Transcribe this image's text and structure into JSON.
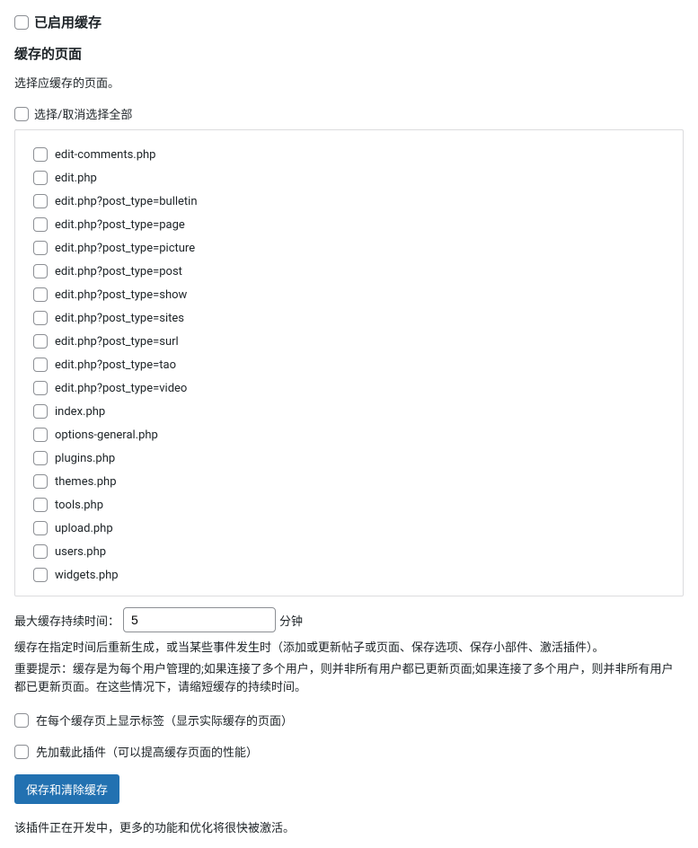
{
  "topCheckbox": {
    "label": "已启用缓存"
  },
  "section": {
    "title": "缓存的页面",
    "help": "选择应缓存的页面。"
  },
  "selectAll": {
    "label": "选择/取消选择全部"
  },
  "pages": [
    "edit-comments.php",
    "edit.php",
    "edit.php?post_type=bulletin",
    "edit.php?post_type=page",
    "edit.php?post_type=picture",
    "edit.php?post_type=post",
    "edit.php?post_type=show",
    "edit.php?post_type=sites",
    "edit.php?post_type=surl",
    "edit.php?post_type=tao",
    "edit.php?post_type=video",
    "index.php",
    "options-general.php",
    "plugins.php",
    "themes.php",
    "tools.php",
    "upload.php",
    "users.php",
    "widgets.php"
  ],
  "duration": {
    "label": "最大缓存持续时间：",
    "value": "5",
    "unit": "分钟"
  },
  "note1": "缓存在指定时间后重新生成，或当某些事件发生时（添加或更新帖子或页面、保存选项、保存小部件、激活插件）。",
  "note2": "重要提示：缓存是为每个用户管理的;如果连接了多个用户，则并非所有用户都已更新页面;如果连接了多个用户，则并非所有用户都已更新页面。在这些情况下，请缩短缓存的持续时间。",
  "optLabel": {
    "showTag": "在每个缓存页上显示标签（显示实际缓存的页面）",
    "preload": "先加载此插件（可以提高缓存页面的性能）"
  },
  "submit": {
    "label": "保存和清除缓存"
  },
  "footer": "该插件正在开发中，更多的功能和优化将很快被激活。"
}
